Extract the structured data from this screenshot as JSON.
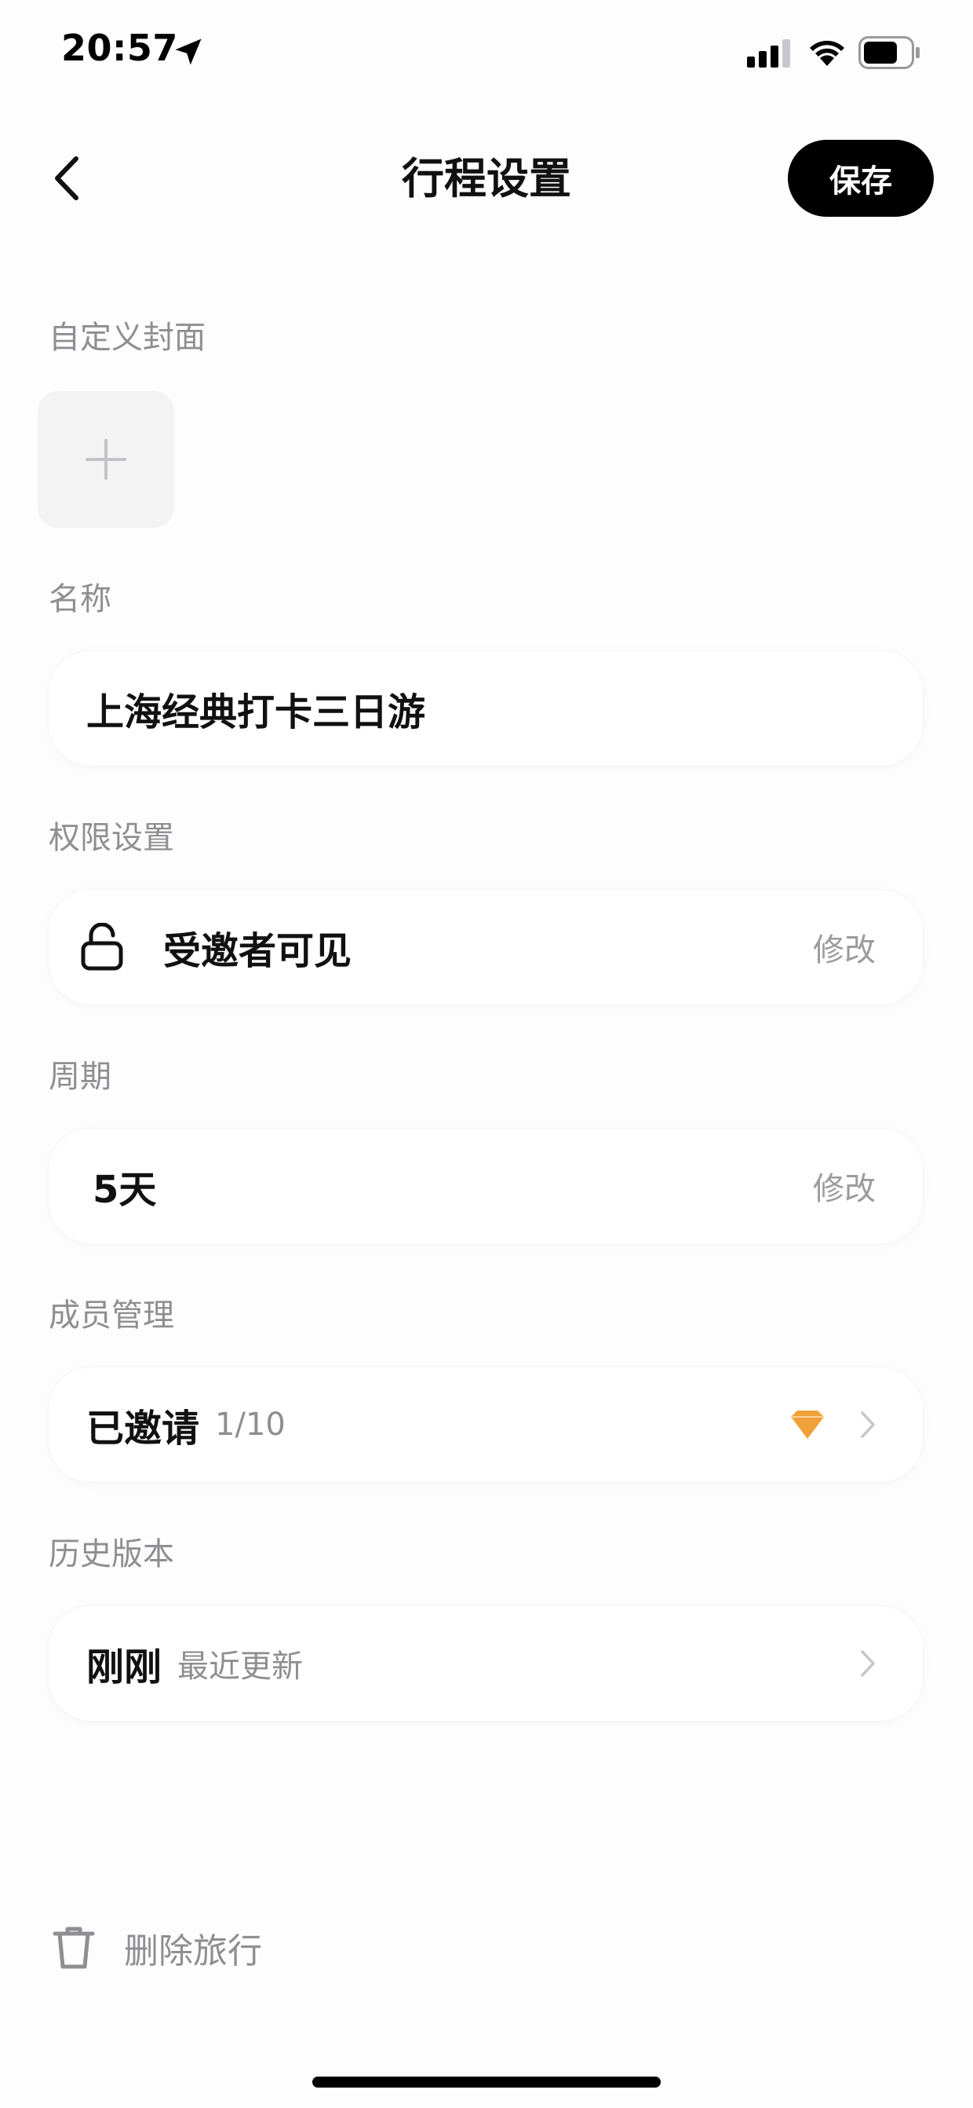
{
  "status_bar": {
    "time": "20:57"
  },
  "nav": {
    "title": "行程设置",
    "save_label": "保存"
  },
  "cover": {
    "label": "自定义封面"
  },
  "name": {
    "label": "名称",
    "value": "上海经典打卡三日游"
  },
  "permission": {
    "label": "权限设置",
    "value": "受邀者可见",
    "action": "修改"
  },
  "period": {
    "label": "周期",
    "value": "5天",
    "action": "修改"
  },
  "members": {
    "label": "成员管理",
    "value": "已邀请",
    "count": "1/10"
  },
  "history": {
    "label": "历史版本",
    "value": "刚刚",
    "sub": "最近更新"
  },
  "delete": {
    "label": "删除旅行"
  },
  "colors": {
    "primary": "#000000",
    "muted": "#8e8e93",
    "gem": "#f0a23a"
  },
  "icons": {
    "back": "chevron-left-icon",
    "add": "plus-icon",
    "lock": "lock-open-icon",
    "gem": "gem-icon",
    "chevron": "chevron-right-icon",
    "delete": "trash-icon"
  }
}
